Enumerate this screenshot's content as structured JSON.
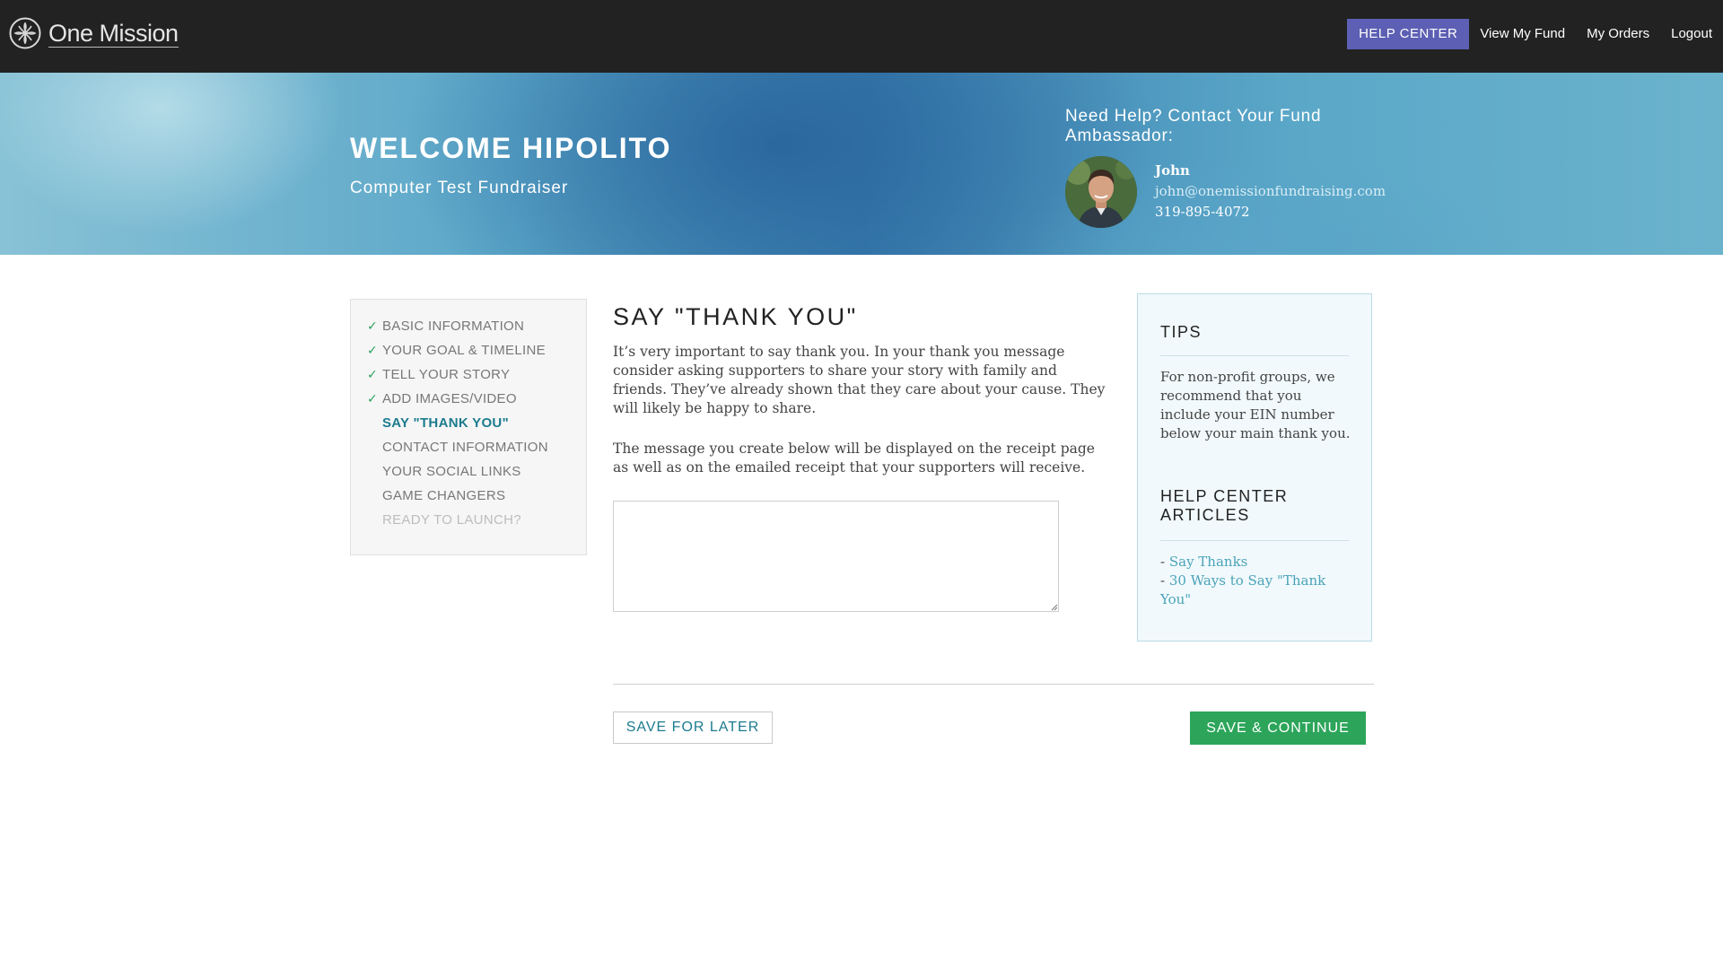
{
  "header": {
    "logo_text": "One Mission",
    "nav": {
      "help_center": "HELP CENTER",
      "view_my_fund": "View My Fund",
      "my_orders": "My Orders",
      "logout": "Logout"
    }
  },
  "hero": {
    "title": "WELCOME HIPOLITO",
    "subtitle": "Computer Test Fundraiser",
    "ambassador": {
      "heading": "Need Help? Contact Your Fund Ambassador:",
      "name": "John",
      "email": "john@onemissionfundraising.com",
      "phone": "319-895-4072"
    }
  },
  "steps": [
    {
      "label": "BASIC INFORMATION",
      "state": "done",
      "check": "✓"
    },
    {
      "label": "YOUR GOAL & TIMELINE",
      "state": "done",
      "check": "✓"
    },
    {
      "label": "TELL YOUR STORY",
      "state": "done",
      "check": "✓"
    },
    {
      "label": "ADD IMAGES/VIDEO",
      "state": "done",
      "check": "✓"
    },
    {
      "label": "SAY \"THANK YOU\"",
      "state": "active"
    },
    {
      "label": "CONTACT INFORMATION",
      "state": "todo"
    },
    {
      "label": "YOUR SOCIAL LINKS",
      "state": "todo"
    },
    {
      "label": "GAME CHANGERS",
      "state": "todo"
    },
    {
      "label": "READY TO LAUNCH?",
      "state": "disabled"
    }
  ],
  "main": {
    "title": "SAY \"THANK YOU\"",
    "paragraph1": "It’s very important to say thank you. In your thank you message consider asking supporters to share your story with family and friends. They’ve already shown that they care about your cause. They will likely be happy to share.",
    "paragraph2": "The message you create below will be displayed on the receipt page as well as on the emailed receipt that your supporters will receive.",
    "message_value": "",
    "save_later": "SAVE FOR LATER",
    "save_continue": "SAVE & CONTINUE"
  },
  "tips": {
    "title": "TIPS",
    "text": "For non-profit groups, we recommend that you include your EIN number below your main thank you.",
    "help_title": "HELP CENTER ARTICLES",
    "articles": [
      {
        "prefix": "- ",
        "label": "Say Thanks"
      },
      {
        "prefix": "- ",
        "label": "30 Ways to Say \"Thank You\""
      }
    ]
  },
  "colors": {
    "topbar": "#222222",
    "help_button": "#5c5fb3",
    "active_step": "#1b7b8e",
    "check": "#2ba25d",
    "continue_button": "#2ca55a",
    "link": "#4aa3b8"
  }
}
